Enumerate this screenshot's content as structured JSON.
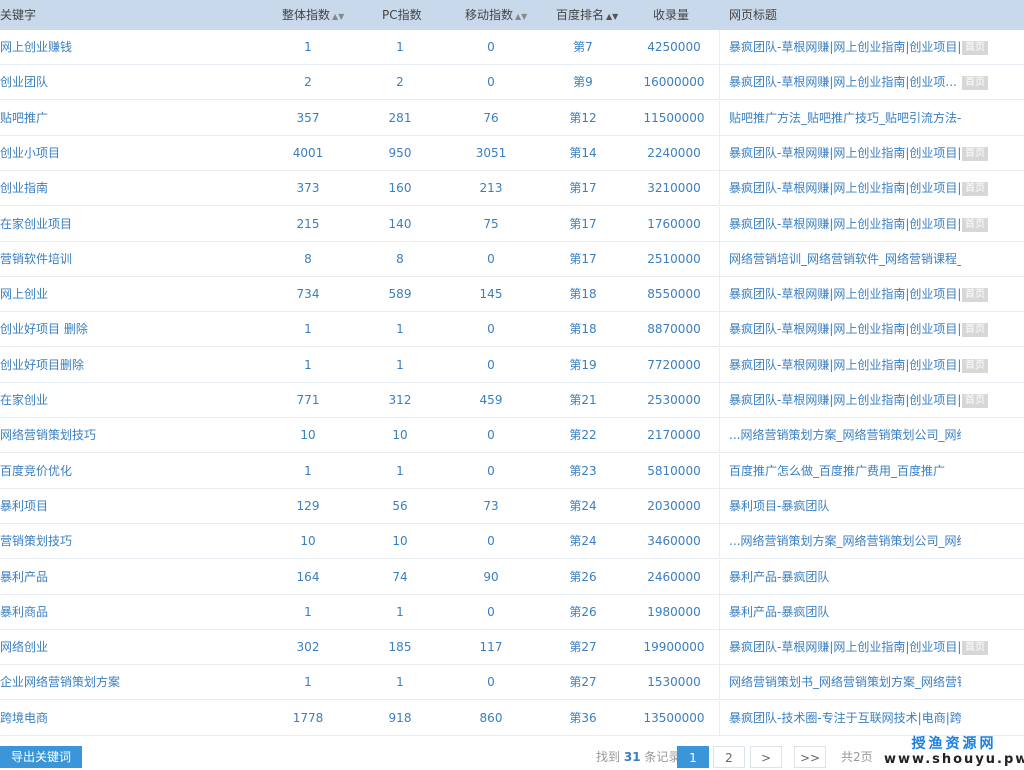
{
  "header": {
    "keyword": "关键字",
    "total": "整体指数",
    "pc": "PC指数",
    "mobile": "移动指数",
    "rank": "百度排名",
    "indexed": "收录量",
    "title": "网页标题"
  },
  "rows": [
    {
      "keyword": "网上创业赚钱",
      "total": "1",
      "pc": "1",
      "mobile": "0",
      "rank": "第7",
      "indexed": "4250000",
      "title": "暴疯团队-草根网赚|网上创业指南|创业项目|...",
      "home": "首页"
    },
    {
      "keyword": "创业团队",
      "total": "2",
      "pc": "2",
      "mobile": "0",
      "rank": "第9",
      "indexed": "16000000",
      "title": "暴疯团队-草根网赚|网上创业指南|创业项...",
      "home": "首页"
    },
    {
      "keyword": "贴吧推广",
      "total": "357",
      "pc": "281",
      "mobile": "76",
      "rank": "第12",
      "indexed": "11500000",
      "title": "贴吧推广方法_贴吧推广技巧_贴吧引流方法-暴...",
      "home": ""
    },
    {
      "keyword": "创业小项目",
      "total": "4001",
      "pc": "950",
      "mobile": "3051",
      "rank": "第14",
      "indexed": "2240000",
      "title": "暴疯团队-草根网赚|网上创业指南|创业项目|...",
      "home": "首页"
    },
    {
      "keyword": "创业指南",
      "total": "373",
      "pc": "160",
      "mobile": "213",
      "rank": "第17",
      "indexed": "3210000",
      "title": "暴疯团队-草根网赚|网上创业指南|创业项目|...",
      "home": "首页"
    },
    {
      "keyword": "在家创业项目",
      "total": "215",
      "pc": "140",
      "mobile": "75",
      "rank": "第17",
      "indexed": "1760000",
      "title": "暴疯团队-草根网赚|网上创业指南|创业项目|...",
      "home": "首页"
    },
    {
      "keyword": "营销软件培训",
      "total": "8",
      "pc": "8",
      "mobile": "0",
      "rank": "第17",
      "indexed": "2510000",
      "title": "网络营销培训_网络营销软件_网络营销课程_网...",
      "home": ""
    },
    {
      "keyword": "网上创业",
      "total": "734",
      "pc": "589",
      "mobile": "145",
      "rank": "第18",
      "indexed": "8550000",
      "title": "暴疯团队-草根网赚|网上创业指南|创业项目|...",
      "home": "首页"
    },
    {
      "keyword": "创业好项目 删除",
      "total": "1",
      "pc": "1",
      "mobile": "0",
      "rank": "第18",
      "indexed": "8870000",
      "title": "暴疯团队-草根网赚|网上创业指南|创业项目|...",
      "home": "首页"
    },
    {
      "keyword": "创业好项目删除",
      "total": "1",
      "pc": "1",
      "mobile": "0",
      "rank": "第19",
      "indexed": "7720000",
      "title": "暴疯团队-草根网赚|网上创业指南|创业项目|...",
      "home": "首页"
    },
    {
      "keyword": "在家创业",
      "total": "771",
      "pc": "312",
      "mobile": "459",
      "rank": "第21",
      "indexed": "2530000",
      "title": "暴疯团队-草根网赚|网上创业指南|创业项目|...",
      "home": "首页"
    },
    {
      "keyword": "网络营销策划技巧",
      "total": "10",
      "pc": "10",
      "mobile": "0",
      "rank": "第22",
      "indexed": "2170000",
      "title": "...网络营销策划方案_网络营销策划公司_网络...",
      "home": ""
    },
    {
      "keyword": "百度竞价优化",
      "total": "1",
      "pc": "1",
      "mobile": "0",
      "rank": "第23",
      "indexed": "5810000",
      "title": "百度推广怎么做_百度推广费用_百度推广",
      "home": ""
    },
    {
      "keyword": "暴利项目",
      "total": "129",
      "pc": "56",
      "mobile": "73",
      "rank": "第24",
      "indexed": "2030000",
      "title": "暴利项目-暴疯团队",
      "home": ""
    },
    {
      "keyword": "营销策划技巧",
      "total": "10",
      "pc": "10",
      "mobile": "0",
      "rank": "第24",
      "indexed": "3460000",
      "title": "...网络营销策划方案_网络营销策划公司_网络...",
      "home": ""
    },
    {
      "keyword": "暴利产品",
      "total": "164",
      "pc": "74",
      "mobile": "90",
      "rank": "第26",
      "indexed": "2460000",
      "title": "暴利产品-暴疯团队",
      "home": ""
    },
    {
      "keyword": "暴利商品",
      "total": "1",
      "pc": "1",
      "mobile": "0",
      "rank": "第26",
      "indexed": "1980000",
      "title": "暴利产品-暴疯团队",
      "home": ""
    },
    {
      "keyword": "网络创业",
      "total": "302",
      "pc": "185",
      "mobile": "117",
      "rank": "第27",
      "indexed": "19900000",
      "title": "暴疯团队-草根网赚|网上创业指南|创业项目|...",
      "home": "首页"
    },
    {
      "keyword": "企业网络营销策划方案",
      "total": "1",
      "pc": "1",
      "mobile": "0",
      "rank": "第27",
      "indexed": "1530000",
      "title": "网络营销策划书_网络营销策划方案_网络营销...",
      "home": ""
    },
    {
      "keyword": "跨境电商",
      "total": "1778",
      "pc": "918",
      "mobile": "860",
      "rank": "第36",
      "indexed": "13500000",
      "title": "暴疯团队-技术圈-专注于互联网技术|电商|跨...",
      "home": ""
    }
  ],
  "footer": {
    "export_label": "导出关键词",
    "found_prefix": "找到",
    "found_count": "31",
    "found_suffix": "条记录",
    "page1": "1",
    "page2": "2",
    "next": ">",
    "last": ">>",
    "total_pages": "共2页"
  },
  "watermark": {
    "line1": "授渔资源网",
    "line2": "www.shouyu.pw"
  }
}
